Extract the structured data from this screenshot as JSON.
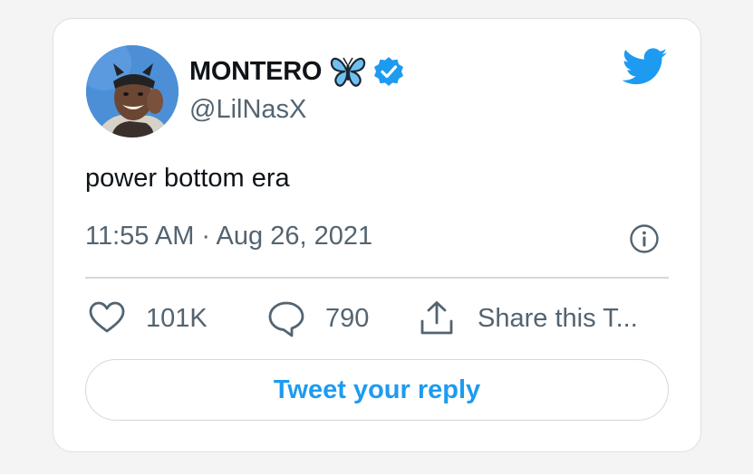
{
  "tweet": {
    "display_name": "MONTERO",
    "handle": "@LilNasX",
    "text": "power bottom era",
    "timestamp": "11:55 AM · Aug 26, 2021",
    "likes": "101K",
    "replies": "790",
    "share_label": "Share this T...",
    "reply_prompt": "Tweet your reply"
  },
  "icons": {
    "profile": "avatar-image",
    "name_emoji": "butterfly-icon",
    "verified": "verified-badge-icon",
    "brand": "twitter-bird-icon",
    "info": "info-icon",
    "like": "heart-icon",
    "reply": "comment-icon",
    "share": "share-icon"
  },
  "colors": {
    "accent": "#1d9bf0",
    "text_primary": "#0f1419",
    "text_secondary": "#536471",
    "divider": "#d2d8dc"
  }
}
